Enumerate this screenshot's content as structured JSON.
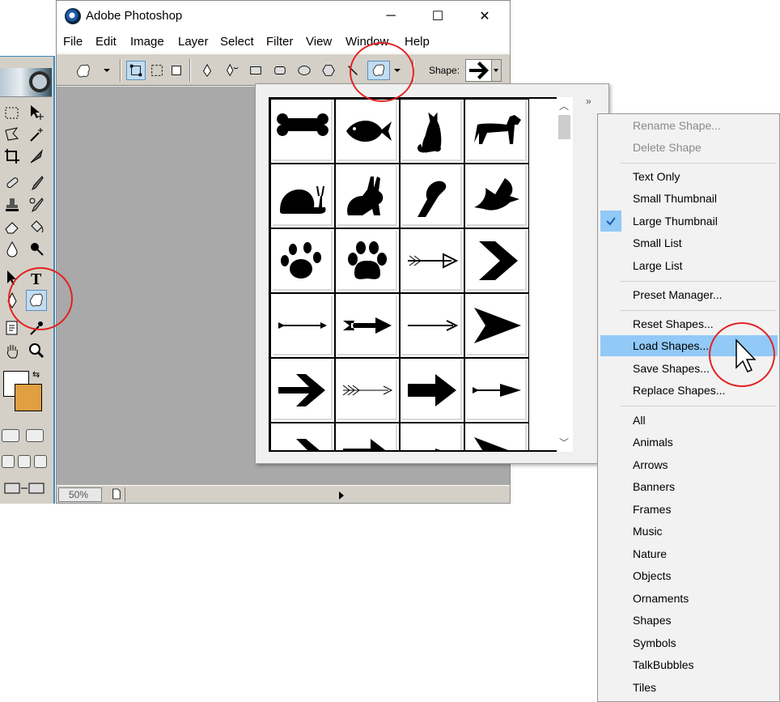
{
  "window": {
    "title": "Adobe Photoshop",
    "minimize": "─",
    "maximize": "☐",
    "close": "✕"
  },
  "menus": [
    {
      "label": "File"
    },
    {
      "label": "Edit"
    },
    {
      "label": "Image"
    },
    {
      "label": "Layer"
    },
    {
      "label": "Select"
    },
    {
      "label": "Filter"
    },
    {
      "label": "View"
    },
    {
      "label": "Window"
    },
    {
      "label": "Help"
    }
  ],
  "options_bar": {
    "shape_label": "Shape:",
    "active_tool": "custom-shape"
  },
  "status": {
    "zoom": "50%"
  },
  "toolbox": {
    "foreground_color": "#ffffff",
    "background_color": "#e0a040",
    "active_tool": "custom-shape"
  },
  "shape_picker": {
    "shapes": [
      "Bone",
      "Fish",
      "Cat",
      "Dog",
      "Snail",
      "Rabbit",
      "Bird",
      "Dove",
      "Paw Print",
      "Paw Print 2",
      "Arrow 1",
      "Sign 1",
      "Arrow 2",
      "Arrow 3",
      "Arrow 4",
      "Arrow 5",
      "Arrow 6",
      "Arrow 7",
      "Arrow 8",
      "Arrow 9"
    ],
    "selected_view": "Large Thumbnail"
  },
  "context_menu": {
    "group1": [
      "Rename Shape...",
      "Delete Shape"
    ],
    "group2": [
      "Text Only",
      "Small Thumbnail",
      "Large Thumbnail",
      "Small List",
      "Large List"
    ],
    "group3": [
      "Preset Manager..."
    ],
    "group4": [
      "Reset Shapes...",
      "Load Shapes...",
      "Save Shapes...",
      "Replace Shapes..."
    ],
    "group5": [
      "All",
      "Animals",
      "Arrows",
      "Banners",
      "Frames",
      "Music",
      "Nature",
      "Objects",
      "Ornaments",
      "Shapes",
      "Symbols",
      "TalkBubbles",
      "Tiles"
    ],
    "checked": "Large Thumbnail",
    "highlighted": "Load Shapes..."
  },
  "colors": {
    "highlight": "#91c9f7",
    "annotation": "#e32222",
    "canvas": "#a9a9a9"
  }
}
